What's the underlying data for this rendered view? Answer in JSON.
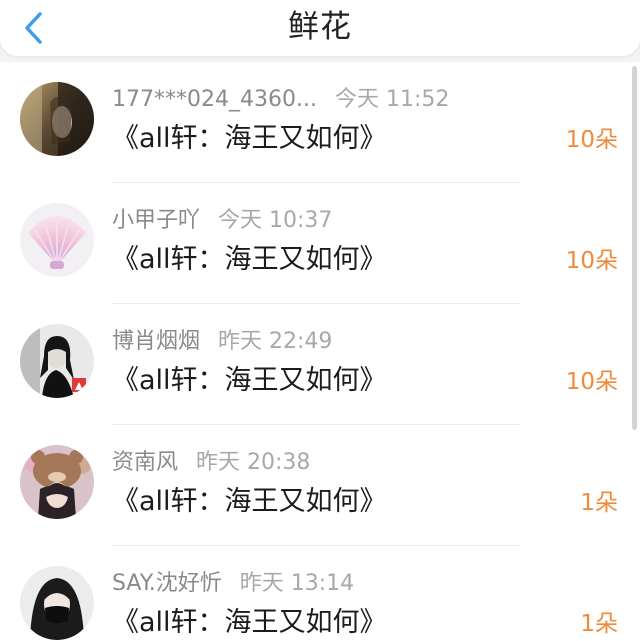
{
  "header": {
    "title": "鲜花",
    "back_icon": "chevron-left-icon",
    "accent_color": "#3a9bf0"
  },
  "list": [
    {
      "name": "177***024_4360...",
      "time": "今天 11:52",
      "book": "《all轩：海王又如何》",
      "count": "10朵"
    },
    {
      "name": "小甲子吖",
      "time": "今天 10:37",
      "book": "《all轩：海王又如何》",
      "count": "10朵"
    },
    {
      "name": "博肖烟烟",
      "time": "昨天 22:49",
      "book": "《all轩：海王又如何》",
      "count": "10朵"
    },
    {
      "name": "资南风",
      "time": "昨天 20:38",
      "book": "《all轩：海王又如何》",
      "count": "1朵"
    },
    {
      "name": "SAY.沈好忻",
      "time": "昨天 13:14",
      "book": "《all轩：海王又如何》",
      "count": "1朵"
    }
  ],
  "colors": {
    "count": "#ef8a3a",
    "meta": "#8a8a8a"
  }
}
